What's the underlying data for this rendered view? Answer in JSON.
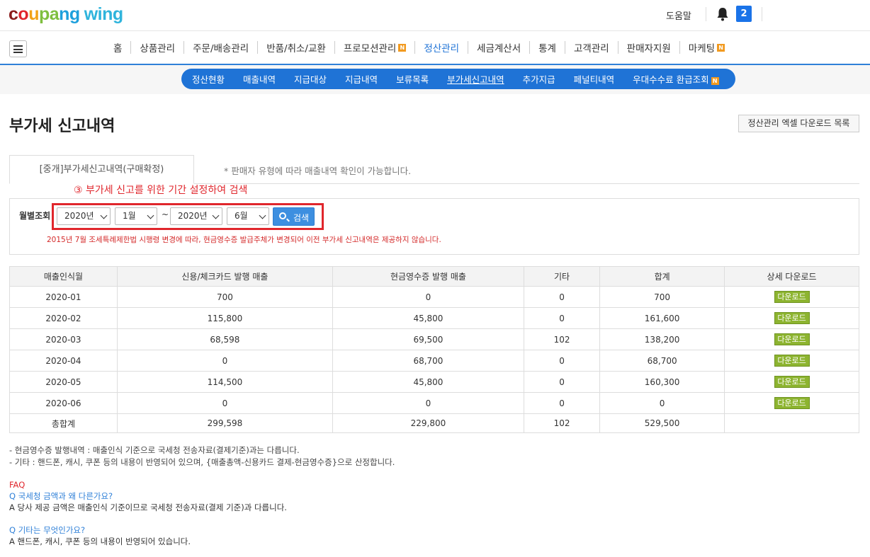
{
  "header": {
    "logo_parts": [
      "c",
      "o",
      "u",
      "pa",
      "ng"
    ],
    "logo_suffix": "wing",
    "help": "도움말",
    "notice_count": "2"
  },
  "nav": {
    "items": [
      {
        "label": "홈",
        "badge": ""
      },
      {
        "label": "상품관리",
        "badge": ""
      },
      {
        "label": "주문/배송관리",
        "badge": ""
      },
      {
        "label": "반품/취소/교환",
        "badge": ""
      },
      {
        "label": "프로모션관리",
        "badge": "N"
      },
      {
        "label": "정산관리",
        "badge": ""
      },
      {
        "label": "세금계산서",
        "badge": ""
      },
      {
        "label": "통계",
        "badge": ""
      },
      {
        "label": "고객관리",
        "badge": ""
      },
      {
        "label": "판매자지원",
        "badge": ""
      },
      {
        "label": "마케팅",
        "badge": "N"
      }
    ],
    "active_index": 5
  },
  "subnav": {
    "items": [
      "정산현황",
      "매출내역",
      "지급대상",
      "지급내역",
      "보류목록",
      "부가세신고내역",
      "추가지급",
      "페널티내역",
      "우대수수료 환급조회"
    ],
    "badge": "N",
    "active_index": 5
  },
  "page": {
    "title": "부가세 신고내역",
    "excel_button": "정산관리 엑셀 다운로드 목록",
    "tab": "[중개]부가세신고내역(구매확정)",
    "tab_note": "* 판매자 유형에 따라 매출내역 확인이 가능합니다.",
    "callout": "③ 부가세 신고를 위한 기간 설정하여 검색"
  },
  "filter": {
    "label": "월별조회",
    "from_year": "2020년",
    "from_month": "1월",
    "tilde": "~",
    "to_year": "2020년",
    "to_month": "6월",
    "search": "검색",
    "warning": "2015년 7월 조세특례제한법 시행령 변경에 따라, 현금영수증 발급주체가 변경되어 이전 부가세 신고내역은 제공하지 않습니다."
  },
  "table": {
    "headers": [
      "매출인식월",
      "신용/체크카드 발행 매출",
      "현금영수증 발행 매출",
      "기타",
      "합계",
      "상세 다운로드"
    ],
    "download_label": "다운로드",
    "rows": [
      [
        "2020-01",
        "700",
        "0",
        "0",
        "700"
      ],
      [
        "2020-02",
        "115,800",
        "45,800",
        "0",
        "161,600"
      ],
      [
        "2020-03",
        "68,598",
        "69,500",
        "102",
        "138,200"
      ],
      [
        "2020-04",
        "0",
        "68,700",
        "0",
        "68,700"
      ],
      [
        "2020-05",
        "114,500",
        "45,800",
        "0",
        "160,300"
      ],
      [
        "2020-06",
        "0",
        "0",
        "0",
        "0"
      ]
    ],
    "total": [
      "총합계",
      "299,598",
      "229,800",
      "102",
      "529,500"
    ]
  },
  "notes": [
    "- 현금영수증 발행내역 : 매출인식 기준으로 국세청 전송자료(결제기준)과는 다릅니다.",
    "- 기타 : 핸드폰, 캐시, 쿠폰 등의 내용이 반영되어 있으며, {매출총액-신용카드 결제-현금영수증}으로 산정합니다."
  ],
  "faq": {
    "title": "FAQ",
    "q1": "Q 국세청 금액과 왜 다른가요?",
    "a1": "A 당사 제공 금액은 매출인식 기준이므로 국세청 전송자료(결제 기준)과 다릅니다.",
    "q2": "Q 기타는 무엇인가요?",
    "a2": "A 핸드폰, 캐시, 쿠폰 등의 내용이 반영되어 있습니다."
  },
  "colors": {
    "brand_blue": "#1f73d6",
    "alert_red": "#e0262c",
    "download_green": "#8db430"
  }
}
